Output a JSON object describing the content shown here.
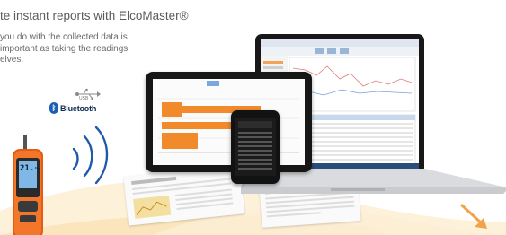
{
  "headline": "te instant reports with ElcoMaster®",
  "subtext_lines": [
    "you do with the collected data is",
    " important as taking the readings",
    "elves."
  ],
  "connectivity": {
    "usb_label": "USB",
    "bluetooth_label": "Bluetooth"
  },
  "meter": {
    "display_value": "21.",
    "display_suffix": "°c"
  },
  "icons": [
    "usb-icon",
    "bluetooth-icon",
    "signal-waves-icon",
    "arrow-icon"
  ],
  "colors": {
    "accent_orange": "#f08a2b",
    "swoosh": "#fbe9c6",
    "bluetooth_blue": "#1c5fb0",
    "device_dark": "#161616"
  }
}
